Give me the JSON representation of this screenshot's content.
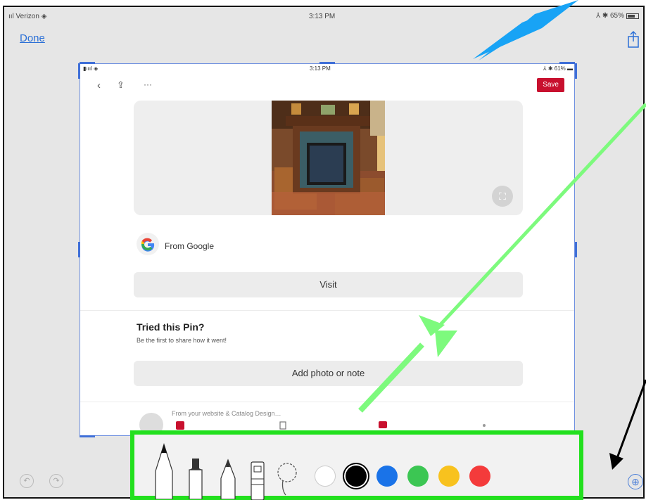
{
  "status": {
    "carrier": "ııl Verizon ◈",
    "time": "3:13 PM",
    "battery": "⅄ ✱ 65%"
  },
  "nav": {
    "done_label": "Done"
  },
  "inner": {
    "status": {
      "left": "▮ıııl ◈",
      "time": "3:13 PM",
      "right": "⅄ ✱ 61% ▬"
    },
    "save_label": "Save",
    "source_label": "From Google",
    "visit_label": "Visit",
    "tried_title": "Tried this Pin?",
    "tried_sub": "Be the first to share how it went!",
    "add_photo_label": "Add photo or note",
    "comment_preview": "From your website & Catalog Design…"
  },
  "palette": {
    "colors": [
      "#ffffff",
      "#000000",
      "#1a73e8",
      "#3cc653",
      "#f8c21e",
      "#f43b3b"
    ]
  },
  "annotations": {
    "box_color": "#22e01e",
    "arrow_blue": "#18a3f5",
    "arrow_green": "#7dfa7d",
    "arrow_black": "#000000"
  },
  "icons": {
    "back": "‹",
    "share": "⇪",
    "more": "···",
    "undo": "↶",
    "redo": "↷",
    "plus": "⊕",
    "expand": "⛶"
  }
}
